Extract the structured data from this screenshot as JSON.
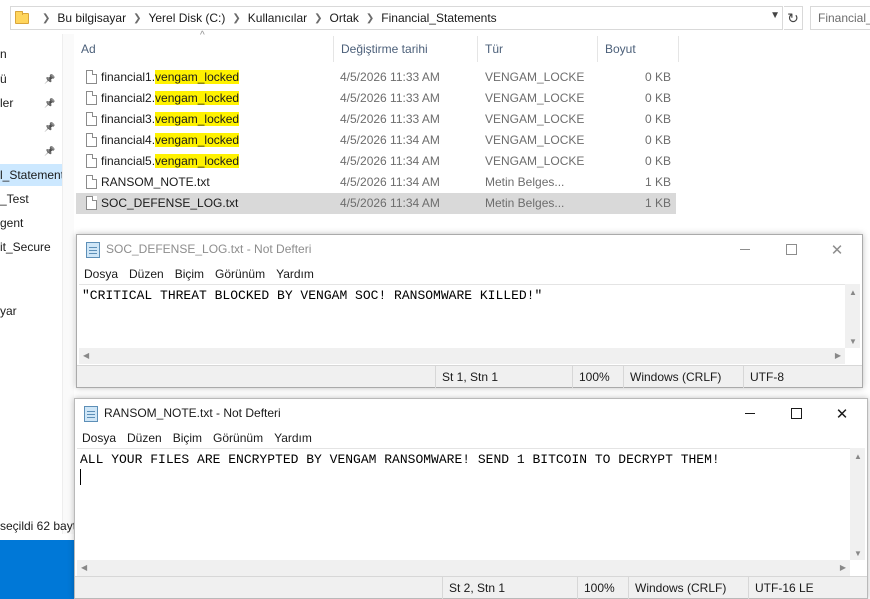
{
  "explorer": {
    "breadcrumbs": [
      "Bu bilgisayar",
      "Yerel Disk (C:)",
      "Kullanıcılar",
      "Ortak",
      "Financial_Statements"
    ],
    "search_placeholder": "Financial_St",
    "nav_items": [
      {
        "label": "n",
        "pinned": false,
        "selected": false
      },
      {
        "label": "ü",
        "pinned": true,
        "selected": false
      },
      {
        "label": "ler",
        "pinned": true,
        "selected": false
      },
      {
        "label": "",
        "pinned": true,
        "selected": false
      },
      {
        "label": "",
        "pinned": true,
        "selected": false
      },
      {
        "label": "l_Statements",
        "pinned": false,
        "selected": true
      },
      {
        "label": "_Test",
        "pinned": false,
        "selected": false
      },
      {
        "label": "gent",
        "pinned": false,
        "selected": false
      },
      {
        "label": "it_Secure",
        "pinned": false,
        "selected": false
      },
      {
        "label": "",
        "pinned": false,
        "selected": false
      },
      {
        "label": "yar",
        "pinned": false,
        "selected": false
      }
    ],
    "columns": {
      "name": "Ad",
      "date": "Değiştirme tarihi",
      "type": "Tür",
      "size": "Boyut"
    },
    "files": [
      {
        "base": "financial1.",
        "ext": "vengam_locked",
        "highlight": true,
        "date": "4/5/2026 11:33 AM",
        "type": "VENGAM_LOCKED",
        "size": "0 KB",
        "selected": false
      },
      {
        "base": "financial2.",
        "ext": "vengam_locked",
        "highlight": true,
        "date": "4/5/2026 11:33 AM",
        "type": "VENGAM_LOCKED",
        "size": "0 KB",
        "selected": false
      },
      {
        "base": "financial3.",
        "ext": "vengam_locked",
        "highlight": true,
        "date": "4/5/2026 11:33 AM",
        "type": "VENGAM_LOCKED",
        "size": "0 KB",
        "selected": false
      },
      {
        "base": "financial4.",
        "ext": "vengam_locked",
        "highlight": true,
        "date": "4/5/2026 11:34 AM",
        "type": "VENGAM_LOCKED",
        "size": "0 KB",
        "selected": false
      },
      {
        "base": "financial5.",
        "ext": "vengam_locked",
        "highlight": true,
        "date": "4/5/2026 11:34 AM",
        "type": "VENGAM_LOCKED",
        "size": "0 KB",
        "selected": false
      },
      {
        "base": "RANSOM_NOTE.txt",
        "ext": "",
        "highlight": false,
        "date": "4/5/2026 11:34 AM",
        "type": "Metin Belgesi",
        "size": "1 KB",
        "selected": false
      },
      {
        "base": "SOC_DEFENSE_LOG.txt",
        "ext": "",
        "highlight": false,
        "date": "4/5/2026 11:34 AM",
        "type": "Metin Belgesi",
        "size": "1 KB",
        "selected": true
      }
    ],
    "status_text": "seçildi  62 bayt"
  },
  "notepad_soc": {
    "title": "SOC_DEFENSE_LOG.txt - Not Defteri",
    "menu": [
      "Dosya",
      "Düzen",
      "Biçim",
      "Görünüm",
      "Yardım"
    ],
    "content": "\"CRITICAL THREAT BLOCKED BY VENGAM SOC! RANSOMWARE KILLED!\"",
    "status": {
      "position": "St 1, Stn 1",
      "zoom": "100%",
      "line_ending": "Windows (CRLF)",
      "encoding": "UTF-8"
    }
  },
  "notepad_ransom": {
    "title": "RANSOM_NOTE.txt - Not Defteri",
    "menu": [
      "Dosya",
      "Düzen",
      "Biçim",
      "Görünüm",
      "Yardım"
    ],
    "content": "ALL YOUR FILES ARE ENCRYPTED BY VENGAM RANSOMWARE! SEND 1 BITCOIN TO DECRYPT THEM!",
    "status": {
      "position": "St 2, Stn 1",
      "zoom": "100%",
      "line_ending": "Windows (CRLF)",
      "encoding": "UTF-16 LE"
    }
  },
  "icons": [
    "folder-icon",
    "refresh-icon",
    "pin-icon",
    "file-icon",
    "notepad-icon",
    "minimize-icon",
    "maximize-icon",
    "close-icon"
  ],
  "colors": {
    "highlight": "#fff200",
    "selection": "#cce8ff",
    "taskbar": "#0078d7"
  }
}
